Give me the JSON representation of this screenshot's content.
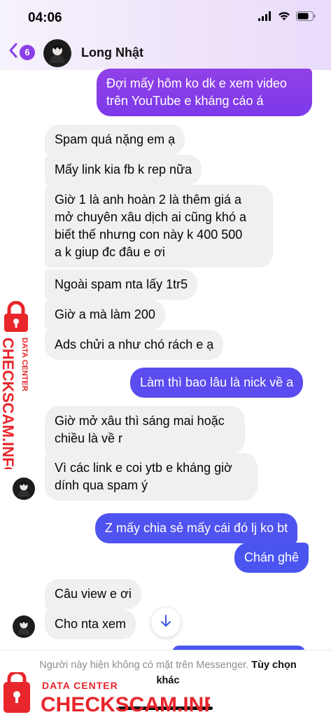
{
  "status_bar": {
    "time": "04:06"
  },
  "header": {
    "unread_count": "6",
    "contact_name": "Long Nhật"
  },
  "messages": [
    {
      "dir": "out",
      "text": "Đợi mấy hôm ko dk e xem video\ntrên YouTube e kháng cáo á"
    },
    {
      "dir": "in",
      "text": "Spam quá nặng em ạ"
    },
    {
      "dir": "in",
      "text": "Mấy link kia fb k rep nữa"
    },
    {
      "dir": "in",
      "text": "Giờ 1 là anh hoàn 2 là thêm giá a\nmở chuyên xâu dịch ai cũng khó a\nbiết thế nhưng con này k 400 500\na k giup đc đâu e ơi"
    },
    {
      "dir": "in",
      "text": "Ngoài spam nta lấy 1tr5"
    },
    {
      "dir": "in",
      "text": "Giờ a mà làm 200"
    },
    {
      "dir": "in",
      "text": "Ads chửi a như chó rách e ạ"
    },
    {
      "dir": "out",
      "text": "Làm thì bao lâu là nick về a"
    },
    {
      "dir": "in",
      "text": "Giờ mở xâu thì sáng mai hoặc\nchiều là về r"
    },
    {
      "dir": "in",
      "text": "Vì các link e coi ytb e kháng giờ\ndính qua spam ý"
    },
    {
      "dir": "out",
      "text": "Z mấy chia sẻ mấy cái đó lj ko bt"
    },
    {
      "dir": "out",
      "text": "Chán ghê"
    },
    {
      "dir": "in",
      "text": "Câu view e ơi"
    },
    {
      "dir": "in",
      "text": "Cho nta xem"
    }
  ],
  "footer": {
    "notice": "Người này hiện không có mặt trên Messenger.",
    "link": "Tùy chọn khác"
  },
  "watermark": {
    "small": "DATA CENTER",
    "large": "CHECKSCAM.INFO"
  },
  "colors": {
    "accent": "#8b3fe9",
    "bubble_purple": "#8438e8",
    "bubble_blue": "#4a55f0",
    "watermark_red": "#e8262b"
  }
}
